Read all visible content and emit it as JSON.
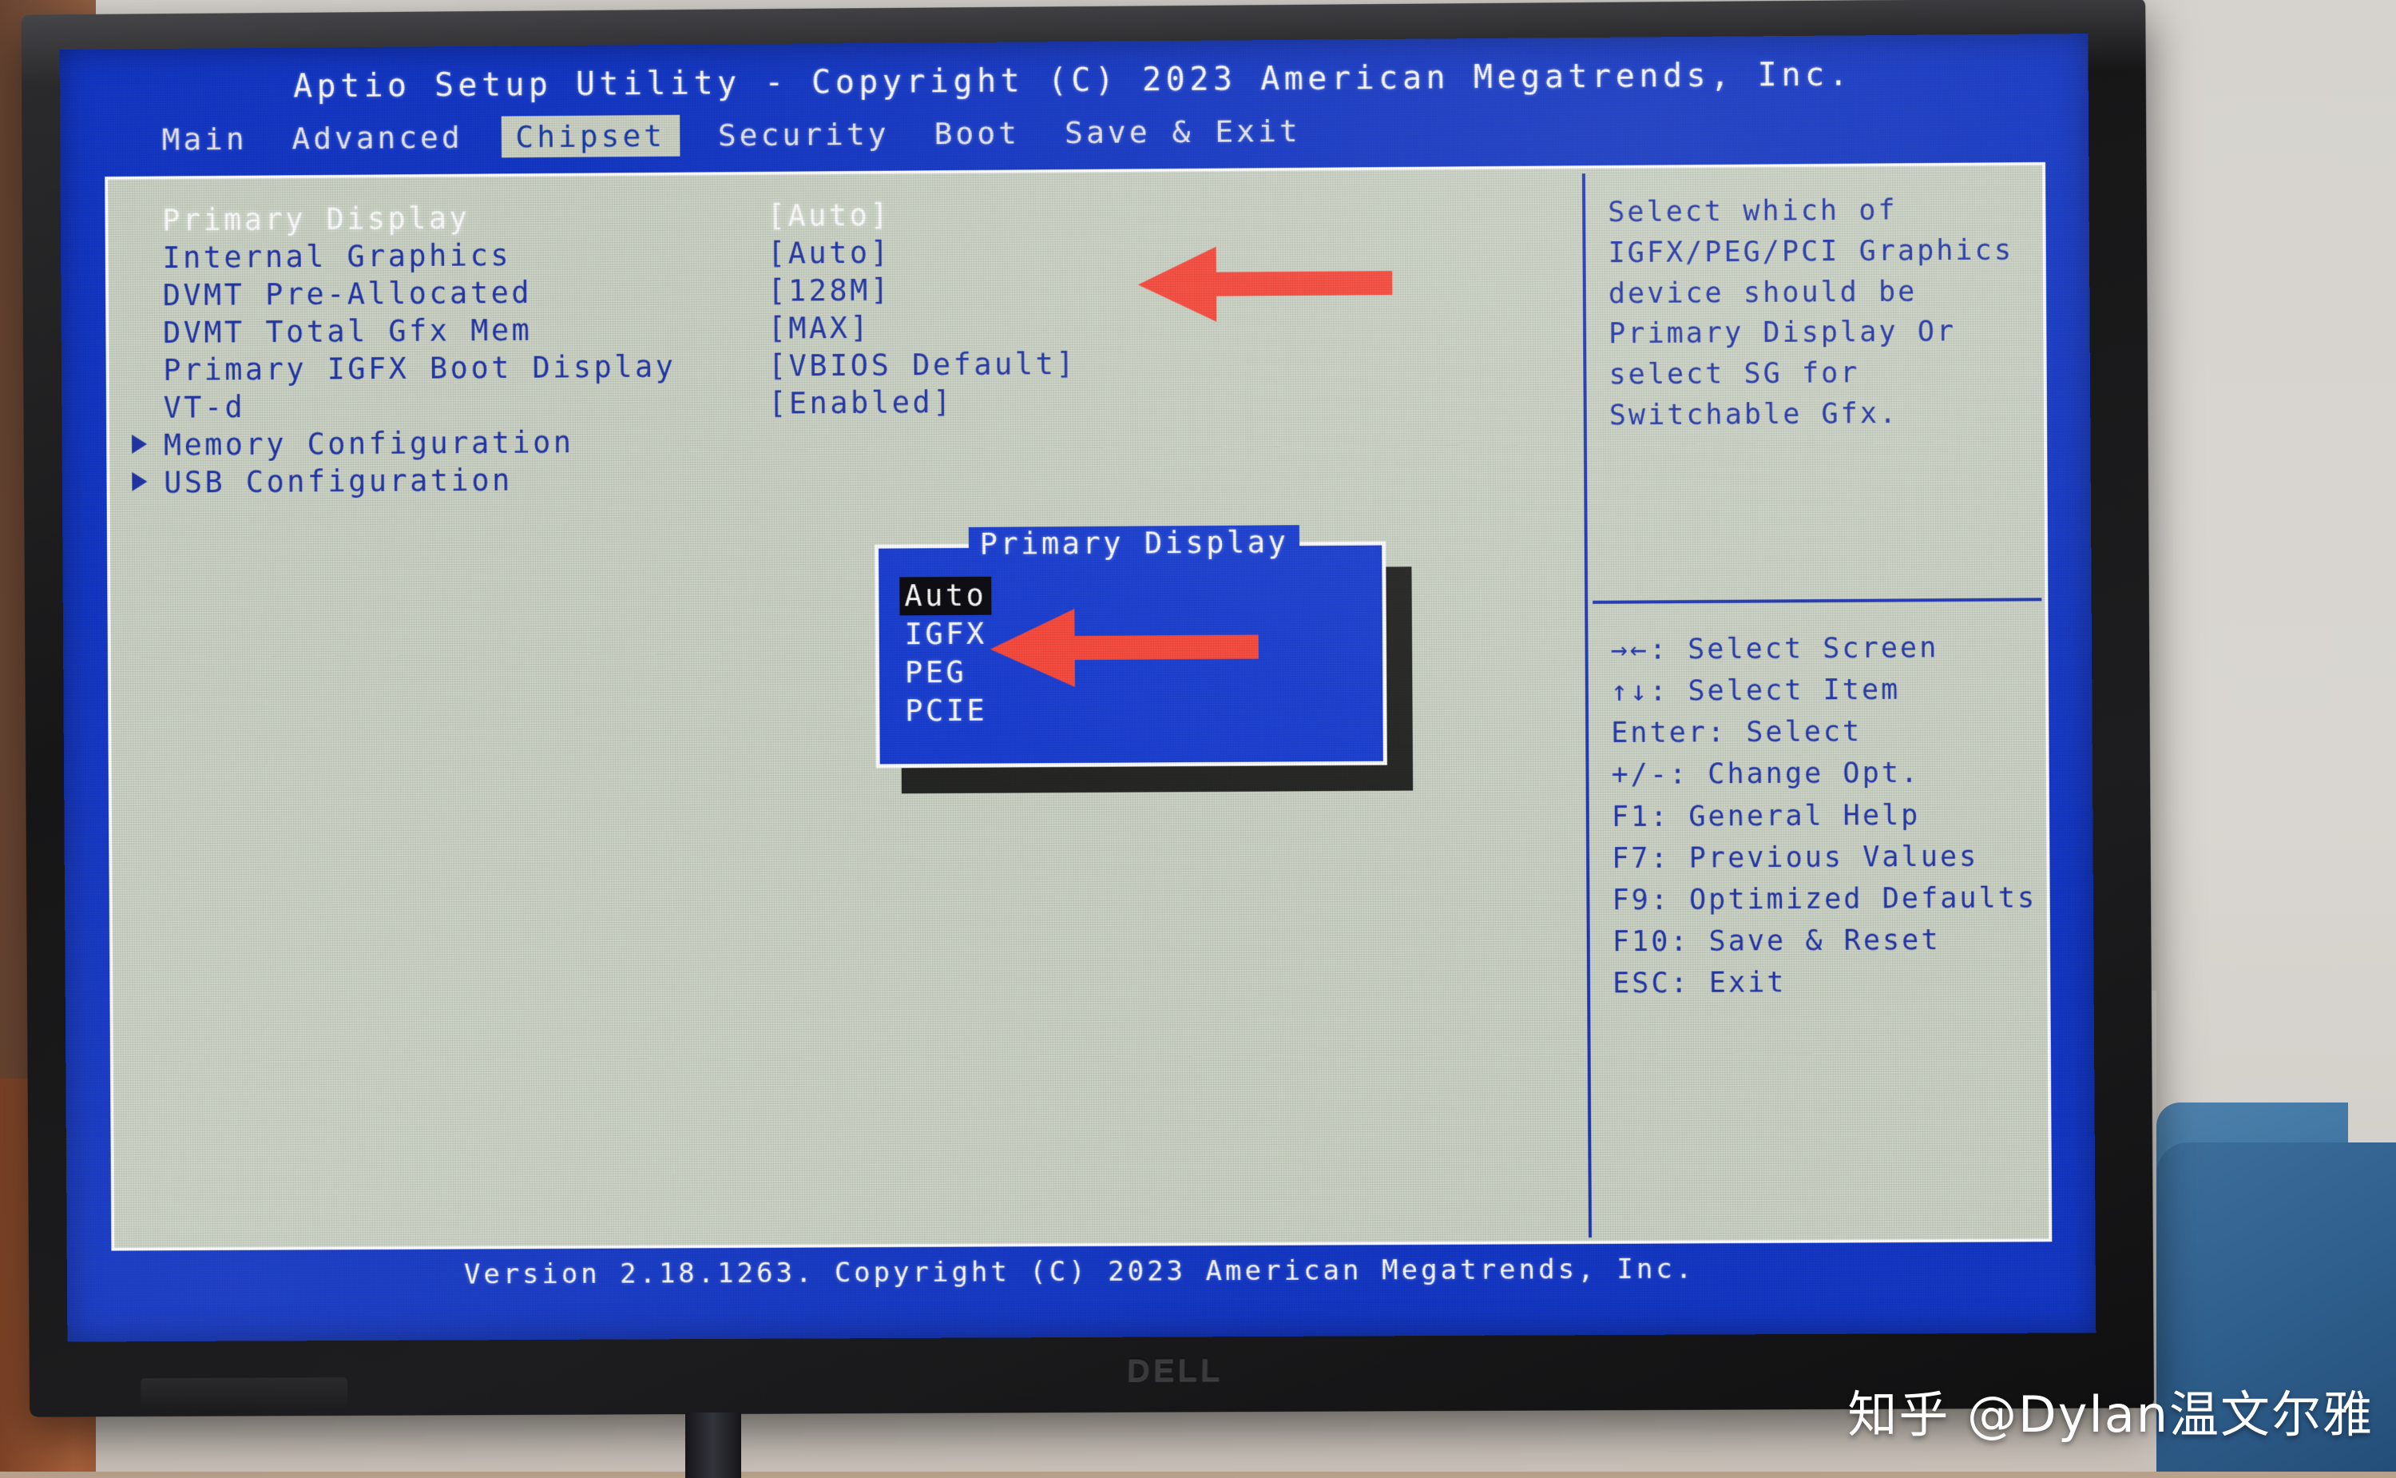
{
  "bios": {
    "title": "Aptio Setup Utility - Copyright (C) 2023 American Megatrends, Inc.",
    "footer": "Version 2.18.1263. Copyright (C) 2023 American Megatrends, Inc.",
    "menu": [
      {
        "label": "Main",
        "active": false
      },
      {
        "label": "Advanced",
        "active": false
      },
      {
        "label": "Chipset",
        "active": true
      },
      {
        "label": "Security",
        "active": false
      },
      {
        "label": "Boot",
        "active": false
      },
      {
        "label": "Save & Exit",
        "active": false
      }
    ],
    "settings": [
      {
        "label": "Primary Display",
        "value": "[Auto]",
        "selected": true,
        "submenu": false
      },
      {
        "label": "Internal Graphics",
        "value": "[Auto]",
        "selected": false,
        "submenu": false
      },
      {
        "label": "DVMT Pre-Allocated",
        "value": "[128M]",
        "selected": false,
        "submenu": false
      },
      {
        "label": "DVMT Total Gfx Mem",
        "value": "[MAX]",
        "selected": false,
        "submenu": false
      },
      {
        "label": "Primary IGFX Boot Display",
        "value": "[VBIOS Default]",
        "selected": false,
        "submenu": false
      },
      {
        "label": "VT-d",
        "value": "[Enabled]",
        "selected": false,
        "submenu": false
      },
      {
        "label": "Memory Configuration",
        "value": "",
        "selected": false,
        "submenu": true
      },
      {
        "label": "USB Configuration",
        "value": "",
        "selected": false,
        "submenu": true
      }
    ],
    "help_text": "Select which of IGFX/PEG/PCI Graphics device should be Primary Display Or select SG for Switchable Gfx.",
    "keys": [
      "→←: Select Screen",
      "↑↓: Select Item",
      "Enter: Select",
      "+/-: Change Opt.",
      "F1: General Help",
      "F7: Previous Values",
      "F9: Optimized Defaults",
      "F10: Save & Reset",
      "ESC: Exit"
    ],
    "popup": {
      "title": "Primary Display",
      "options": [
        {
          "label": "Auto",
          "selected": true
        },
        {
          "label": "IGFX",
          "selected": false
        },
        {
          "label": "PEG",
          "selected": false
        },
        {
          "label": "PCIE",
          "selected": false
        }
      ]
    }
  },
  "hardware": {
    "monitor_brand": "DELL"
  },
  "annotations": {
    "arrow_color": "#fa4a3c",
    "arrow_1_target": "Primary Display value [Auto]",
    "arrow_2_target": "IGFX option in popup"
  },
  "watermark": {
    "text": "知乎 @Dylan温文尔雅"
  }
}
